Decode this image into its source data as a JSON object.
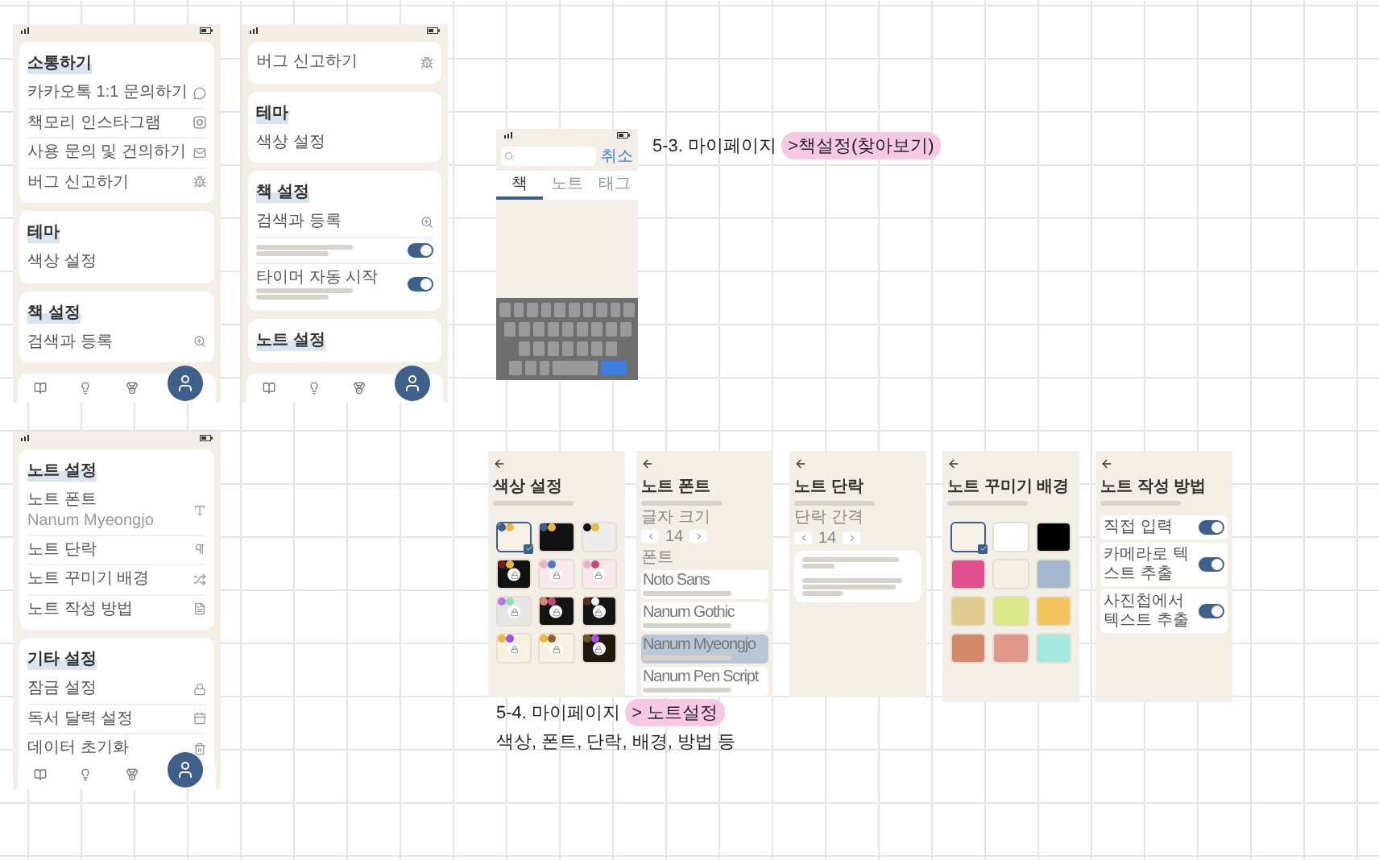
{
  "board_labels": [
    {
      "title": "5-3. 마이페이지 ",
      "highlight": ">책설정(찾아보기)"
    },
    {
      "title": "5-4. 마이페이지 ",
      "highlight": "> 노트설정",
      "subtitle": "색상, 폰트, 단락, 배경, 방법 등"
    }
  ],
  "settings_screens": [
    {
      "sections": [
        {
          "title": "소통하기",
          "items": [
            {
              "kind": "link",
              "label": "카카오톡 1:1 문의하기"
            },
            {
              "kind": "link",
              "label": "책모리 인스타그램"
            },
            {
              "kind": "link",
              "label": "사용 문의 및 건의하기"
            },
            {
              "kind": "link",
              "label": "버그 신고하기"
            }
          ]
        },
        {
          "title": "테마",
          "items": [
            {
              "kind": "link",
              "label": "색상 설정"
            }
          ]
        },
        {
          "title": "책 설정",
          "items": [
            {
              "kind": "link",
              "label": "검색과 등록"
            }
          ]
        }
      ],
      "nav": [
        {
          "selected": false
        },
        {
          "selected": false
        },
        {
          "selected": false
        },
        {
          "selected": true
        }
      ]
    },
    {
      "sections": [
        {
          "items": [
            {
              "kind": "link",
              "label": "버그 신고하기"
            }
          ]
        },
        {
          "title": "테마",
          "items": [
            {
              "kind": "link",
              "label": "색상 설정"
            }
          ]
        },
        {
          "title": "책 설정",
          "items": [
            {
              "kind": "link",
              "label": "검색과 등록"
            },
            {
              "kind": "toggle",
              "on": true
            },
            {
              "kind": "toggle",
              "label": "타이머 자동 시작",
              "on": true
            }
          ]
        },
        {
          "title": "노트 설정"
        }
      ],
      "nav": [
        {
          "selected": false
        },
        {
          "selected": false
        },
        {
          "selected": false
        },
        {
          "selected": true
        }
      ]
    },
    {
      "sections": [
        {
          "title": "노트 설정",
          "items": [
            {
              "kind": "link",
              "label": "노트 폰트",
              "sublabel": "Nanum Myeongjo"
            },
            {
              "kind": "link",
              "label": "노트 단락"
            },
            {
              "kind": "link",
              "label": "노트 꾸미기 배경"
            },
            {
              "kind": "link",
              "label": "노트 작성 방법"
            }
          ]
        },
        {
          "title": "기타 설정",
          "items": [
            {
              "kind": "link",
              "label": "잠금 설정"
            },
            {
              "kind": "link",
              "label": "독서 달력 설정"
            },
            {
              "kind": "link",
              "label": "데이터 초기화"
            }
          ]
        }
      ],
      "nav": [
        {
          "selected": false
        },
        {
          "selected": false
        },
        {
          "selected": false
        },
        {
          "selected": true
        }
      ]
    }
  ],
  "search_screen": {
    "cancel": "취소",
    "tabs": [
      {
        "label": "책",
        "selected": true
      },
      {
        "label": "노트",
        "selected": false
      },
      {
        "label": "태그",
        "selected": false
      }
    ]
  },
  "note_screens": [
    {
      "kind": "colors",
      "title": "색상 설정",
      "swatches": [
        {
          "color": "#f7f1e6",
          "dots": [
            {
              "color": "#3d5f8a"
            },
            {
              "color": "#e8b93b"
            }
          ],
          "locked": false,
          "selected": true
        },
        {
          "color": "#111111",
          "dots": [
            {
              "color": "#3d5f8a"
            },
            {
              "color": "#e8b93b"
            }
          ],
          "locked": false,
          "selected": false
        },
        {
          "color": "#ececec",
          "dots": [
            {
              "color": "#111111"
            },
            {
              "color": "#e8b93b"
            }
          ],
          "locked": false,
          "selected": false
        },
        {
          "color": "#111111",
          "dots": [
            {
              "color": "#7a1a1a"
            },
            {
              "color": "#e8b93b"
            }
          ],
          "locked": true,
          "selected": false
        },
        {
          "color": "#f6e8ec",
          "dots": [
            {
              "color": "#e9b0c8"
            },
            {
              "color": "#4a7ac8"
            }
          ],
          "locked": true,
          "selected": false
        },
        {
          "color": "#f6e8ec",
          "dots": [
            {
              "color": "#e9b0c8"
            },
            {
              "color": "#c9487a"
            }
          ],
          "locked": true,
          "selected": false
        },
        {
          "color": "#e6e6e6",
          "dots": [
            {
              "color": "#b377e6"
            },
            {
              "color": "#8fe0a8"
            }
          ],
          "locked": true,
          "selected": false
        },
        {
          "color": "#141414",
          "dots": [
            {
              "color": "#d98a6a"
            },
            {
              "color": "#c9487a"
            }
          ],
          "locked": true,
          "selected": false
        },
        {
          "color": "#161616",
          "dots": [
            {
              "color": "#5a2a1a"
            },
            {
              "color": "#f5f5f5"
            }
          ],
          "locked": true,
          "selected": false
        },
        {
          "color": "#f7f1e0",
          "dots": [
            {
              "color": "#e8b93b"
            },
            {
              "color": "#b04be6"
            }
          ],
          "locked": true,
          "selected": false
        },
        {
          "color": "#f8f2e2",
          "dots": [
            {
              "color": "#e8b93b"
            },
            {
              "color": "#9a5a2a"
            }
          ],
          "locked": true,
          "selected": false
        },
        {
          "color": "#1e1a0e",
          "dots": [
            {
              "color": "#6b5a1a"
            },
            {
              "color": "#b04be6"
            }
          ],
          "locked": true,
          "selected": false
        }
      ]
    },
    {
      "kind": "font",
      "title": "노트 폰트",
      "size_label": "글자 크기",
      "size": "14",
      "fonts_label": "폰트",
      "fonts": [
        {
          "name": "Noto Sans",
          "selected": false
        },
        {
          "name": "Nanum Gothic",
          "selected": false
        },
        {
          "name": "Nanum Myeongjo",
          "selected": true
        },
        {
          "name": "Nanum Pen Script",
          "selected": false
        }
      ]
    },
    {
      "kind": "paragraph",
      "title": "노트 단락",
      "spacing_label": "단락 간격",
      "spacing": "14"
    },
    {
      "kind": "background",
      "title": "노트 꾸미기 배경",
      "swatches": [
        {
          "color": "#f7f1e6",
          "selected": true
        },
        {
          "color": "#ffffff",
          "selected": false
        },
        {
          "color": "#000000",
          "selected": false
        },
        {
          "color": "#e0508f",
          "selected": false
        },
        {
          "color": "#f5efe6",
          "selected": false
        },
        {
          "color": "#a3b8cf",
          "selected": false
        },
        {
          "color": "#e0cc8e",
          "selected": false
        },
        {
          "color": "#dbe88a",
          "selected": false
        },
        {
          "color": "#f2c55c",
          "selected": false
        },
        {
          "color": "#d48a6a",
          "selected": false
        },
        {
          "color": "#e0988a",
          "selected": false
        },
        {
          "color": "#a4e8df",
          "selected": false
        }
      ]
    },
    {
      "kind": "method",
      "title": "노트 작성 방법",
      "options": [
        {
          "label": "직접 입력",
          "on": true
        },
        {
          "label": "카메라로 텍스트 추출",
          "on": true
        },
        {
          "label": "사진첩에서 텍스트 추출",
          "on": true
        }
      ]
    }
  ]
}
